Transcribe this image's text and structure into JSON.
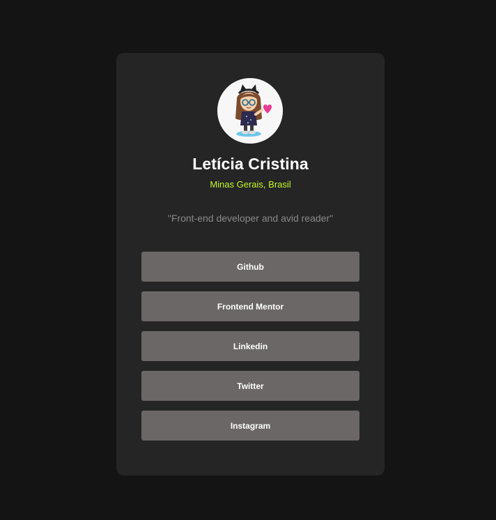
{
  "profile": {
    "name": "Letícia Cristina",
    "location": "Minas Gerais, Brasil",
    "bio": "\"Front-end developer and avid reader\"",
    "avatar_icon": "cartoon-girl-avatar-icon"
  },
  "colors": {
    "page_background": "#141414",
    "card_background": "#252525",
    "accent": "#c4f82a",
    "button_background": "#6b6766",
    "bio_text": "#8a8a8a"
  },
  "links": [
    {
      "label": "Github"
    },
    {
      "label": "Frontend Mentor"
    },
    {
      "label": "Linkedin"
    },
    {
      "label": "Twitter"
    },
    {
      "label": "Instagram"
    }
  ]
}
